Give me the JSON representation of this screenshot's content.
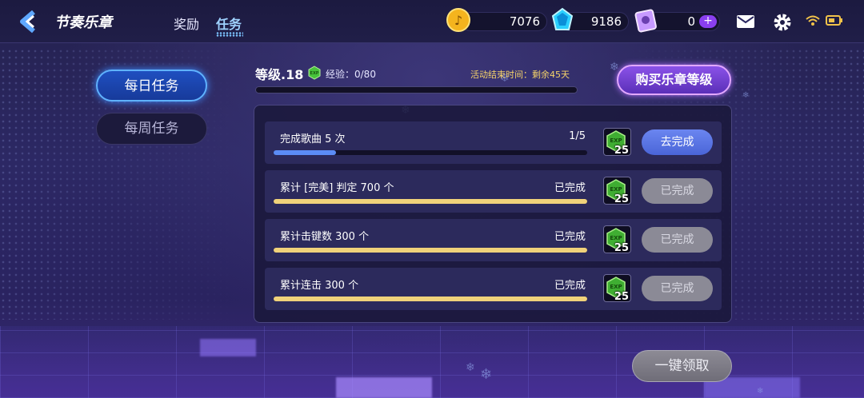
{
  "header": {
    "title": "节奏乐章",
    "tabs": [
      {
        "label": "奖励",
        "active": false
      },
      {
        "label": "任务",
        "active": true
      }
    ],
    "resources": {
      "coins": "7076",
      "gems": "9186",
      "tickets": "0"
    }
  },
  "sidebar": {
    "items": [
      {
        "label": "每日任务",
        "active": true
      },
      {
        "label": "每周任务",
        "active": false
      }
    ]
  },
  "level": {
    "label": "等级.18",
    "exp_badge": "EXP",
    "exp_text": "经验：0/80",
    "exp_progress": 0,
    "event_time": "活动结束时间：剩余45天",
    "buy_button": "购买乐章等级"
  },
  "tasks": [
    {
      "title": "完成歌曲 5 次",
      "status": "1/5",
      "progress": 0.2,
      "reward_badge": "EXP",
      "reward": "25",
      "button": "去完成",
      "completed": false
    },
    {
      "title": "累计 [完美] 判定 700 个",
      "status": "已完成",
      "progress": 1.0,
      "reward_badge": "EXP",
      "reward": "25",
      "button": "已完成",
      "completed": true
    },
    {
      "title": "累计击键数 300 个",
      "status": "已完成",
      "progress": 1.0,
      "reward_badge": "EXP",
      "reward": "25",
      "button": "已完成",
      "completed": true
    },
    {
      "title": "累计连击 300 个",
      "status": "已完成",
      "progress": 1.0,
      "reward_badge": "EXP",
      "reward": "25",
      "button": "已完成",
      "completed": true
    }
  ],
  "claim_all_button": "一键领取",
  "colors": {
    "progress_active": "#5b8cf5",
    "progress_done": "#f0d27a",
    "accent_purple": "#8a52e8"
  },
  "icons": [
    "back-arrow-icon",
    "coin-icon",
    "gem-icon",
    "ticket-icon",
    "mail-icon",
    "gear-icon",
    "wifi-icon",
    "battery-icon",
    "exp-hexagon-icon"
  ]
}
